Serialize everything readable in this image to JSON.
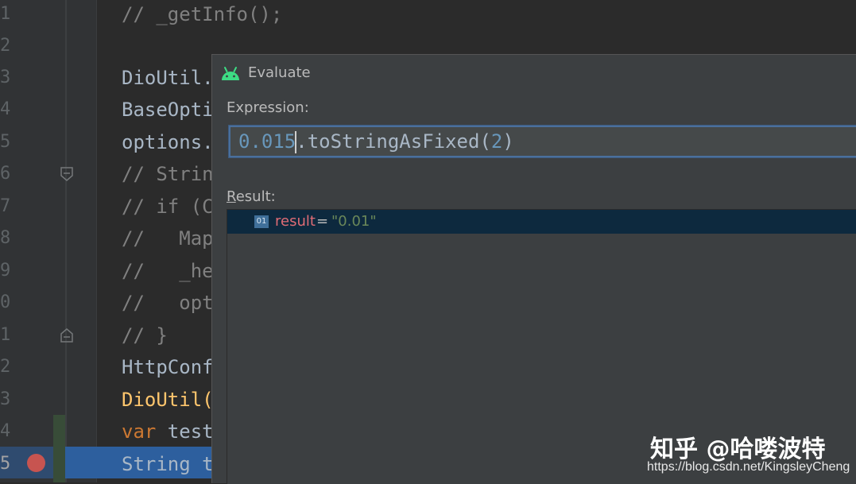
{
  "editor": {
    "line_numbers": [
      "1",
      "2",
      "3",
      "4",
      "5",
      "6",
      "7",
      "8",
      "9",
      "0",
      "1",
      "2",
      "3",
      "4",
      "5"
    ],
    "lines": [
      {
        "text": "// _getInfo();",
        "kind": "comment"
      },
      {
        "text": "",
        "kind": "plain"
      },
      {
        "text": "DioUtil.",
        "kind": "plain"
      },
      {
        "text": "BaseOpti",
        "kind": "plain"
      },
      {
        "text": "options.",
        "kind": "plain"
      },
      {
        "text": "// Strin",
        "kind": "comment"
      },
      {
        "text": "// if (C",
        "kind": "comment"
      },
      {
        "text": "//   Map",
        "kind": "comment"
      },
      {
        "text": "//   _he",
        "kind": "comment"
      },
      {
        "text": "//   opt",
        "kind": "comment"
      },
      {
        "text": "// }",
        "kind": "comment"
      },
      {
        "text": "HttpConf",
        "kind": "plain"
      },
      {
        "text": "DioUtil(",
        "kind": "function"
      },
      {
        "keyword": "var",
        "text": " test",
        "kind": "keyword"
      },
      {
        "text": "String t",
        "kind": "plain"
      }
    ]
  },
  "dialog": {
    "title": "Evaluate",
    "icon": "android-icon",
    "expression_label": "Expression:",
    "expression": {
      "number": "0.015",
      "method": ".toStringAsFixed(",
      "arg": "2",
      "close": ")"
    },
    "result_label_first": "R",
    "result_label_rest": "esult:",
    "result": {
      "icon_text": "01",
      "name": "result",
      "equals": "=",
      "value": "\"0.01\""
    }
  },
  "watermark": {
    "main": "知乎 @哈喽波特",
    "url": "https://blog.csdn.net/KingsleyCheng"
  },
  "colors": {
    "editor_bg": "#2b2b2b",
    "dialog_bg": "#3c3f41",
    "selection": "#2d5f9e",
    "breakpoint": "#c75450",
    "result_row": "#0d293e"
  }
}
